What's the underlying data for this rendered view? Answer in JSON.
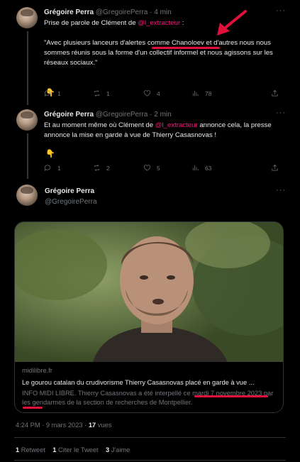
{
  "tweets": [
    {
      "author_name": "Grégoire Perra",
      "handle": "@GregoirePerra",
      "time": "4 min",
      "text_before_mention": "Prise de parole de Clément de ",
      "mention": "@l_extracteur",
      "text_after_mention": " :",
      "quote": "\"Avec plusieurs lanceurs d'alertes comme Chanoloev et d'autres nous nous sommes réunis sous la forme d'un collectif informel et nous agissons sur les réseaux sociaux.\"",
      "emoji": "👇",
      "replies": "1",
      "retweets": "1",
      "likes": "4",
      "views": "78"
    },
    {
      "author_name": "Grégoire Perra",
      "handle": "@GregoirePerra",
      "time": "2 min",
      "text_before_mention": "Et au moment même où Clément de ",
      "mention": "@l_extracteur",
      "text_after_mention": " annonce cela, la presse annonce la mise en garde à vue de Thierry Casasnovas !",
      "emoji": "👇",
      "replies": "1",
      "retweets": "2",
      "likes": "5",
      "views": "63"
    }
  ],
  "main_tweet": {
    "author_name": "Grégoire Perra",
    "handle": "@GregoirePerra",
    "card": {
      "domain": "midilibre.fr",
      "title": "Le gourou catalan du crudivorisme Thierry Casasnovas placé en garde à vue ...",
      "description": "INFO MIDI LIBRE. Thierry Casasnovas a été interpellé ce mardi 7 novembre 2023 par les gendarmes de la section de recherches de Montpellier."
    },
    "timestamp": "4:24 PM · 9 mars 2023 · ",
    "views_count": "17",
    "views_label": " vues",
    "retweets_count": "1",
    "retweets_label": " Retweet",
    "quotes_count": "1",
    "quotes_label": " Citer le Tweet",
    "likes_count": "3",
    "likes_label": " J'aime"
  },
  "colors": {
    "mention": "#f91880",
    "annotation": "#e0103a",
    "muted": "#71767b"
  }
}
